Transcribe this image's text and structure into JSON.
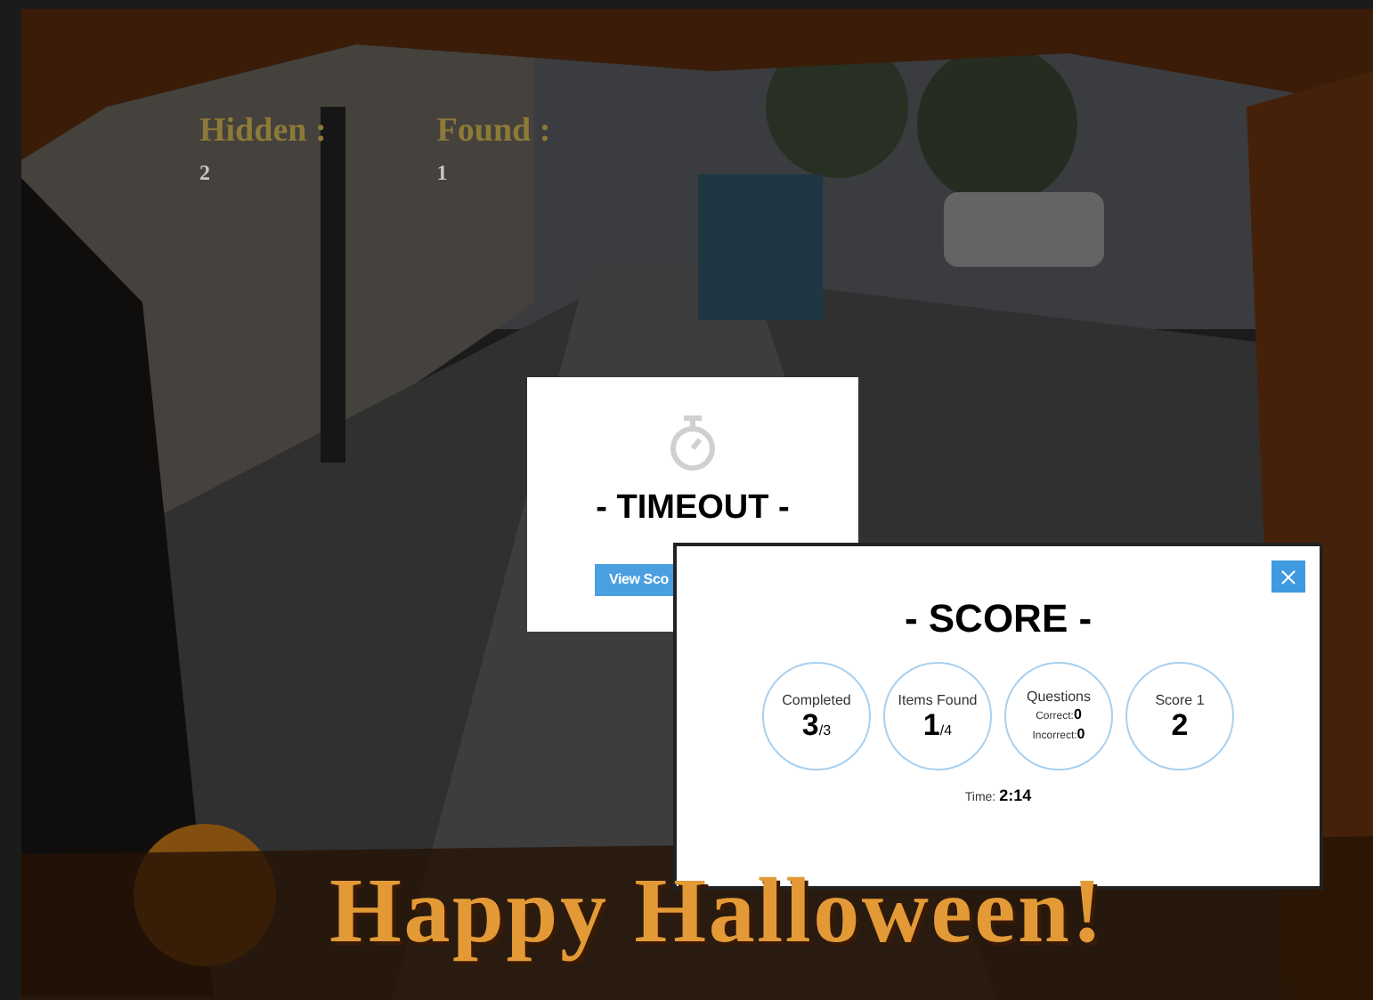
{
  "hud": [
    {
      "label": "Hidden :",
      "value": "2"
    },
    {
      "label": "Found :",
      "value": "1"
    }
  ],
  "timeout_dialog": {
    "title": "- TIMEOUT -",
    "button": "View Sco"
  },
  "score_dialog": {
    "title": "- SCORE -",
    "stats": [
      {
        "kind": "fraction",
        "label": "Completed",
        "value": "3",
        "total": "/3"
      },
      {
        "kind": "fraction",
        "label": "Items Found",
        "value": "1",
        "total": "/4"
      },
      {
        "kind": "questions",
        "label": "Questions",
        "lines": [
          {
            "label": "Correct:",
            "value": "0"
          },
          {
            "label": "Incorrect:",
            "value": "0"
          }
        ]
      },
      {
        "kind": "plain",
        "label": "Score 1",
        "value": "2"
      }
    ],
    "time_label": "Time:",
    "time": "2:14"
  },
  "banner": "Happy Halloween!"
}
